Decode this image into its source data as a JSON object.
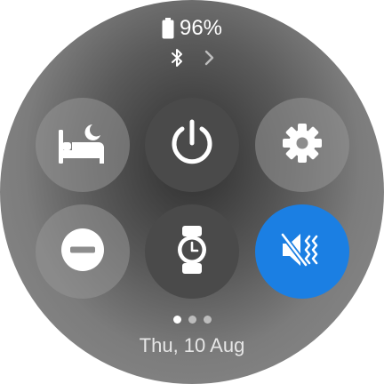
{
  "status": {
    "battery_text": "96%",
    "battery_level": 0.96
  },
  "tiles": [
    {
      "name": "bedtime",
      "icon": "bed-moon-icon",
      "active": false
    },
    {
      "name": "power",
      "icon": "power-icon",
      "active": false
    },
    {
      "name": "settings",
      "icon": "gear-icon",
      "active": false
    },
    {
      "name": "do-not-disturb",
      "icon": "minus-circle-icon",
      "active": false
    },
    {
      "name": "watch-mode",
      "icon": "watch-icon",
      "active": false
    },
    {
      "name": "sound-mute",
      "icon": "vibrate-mute-icon",
      "active": true
    }
  ],
  "colors": {
    "active_tile": "#1b7fe3",
    "text": "#ffffff"
  },
  "pager": {
    "count": 3,
    "active_index": 0
  },
  "date_text": "Thu, 10 Aug"
}
